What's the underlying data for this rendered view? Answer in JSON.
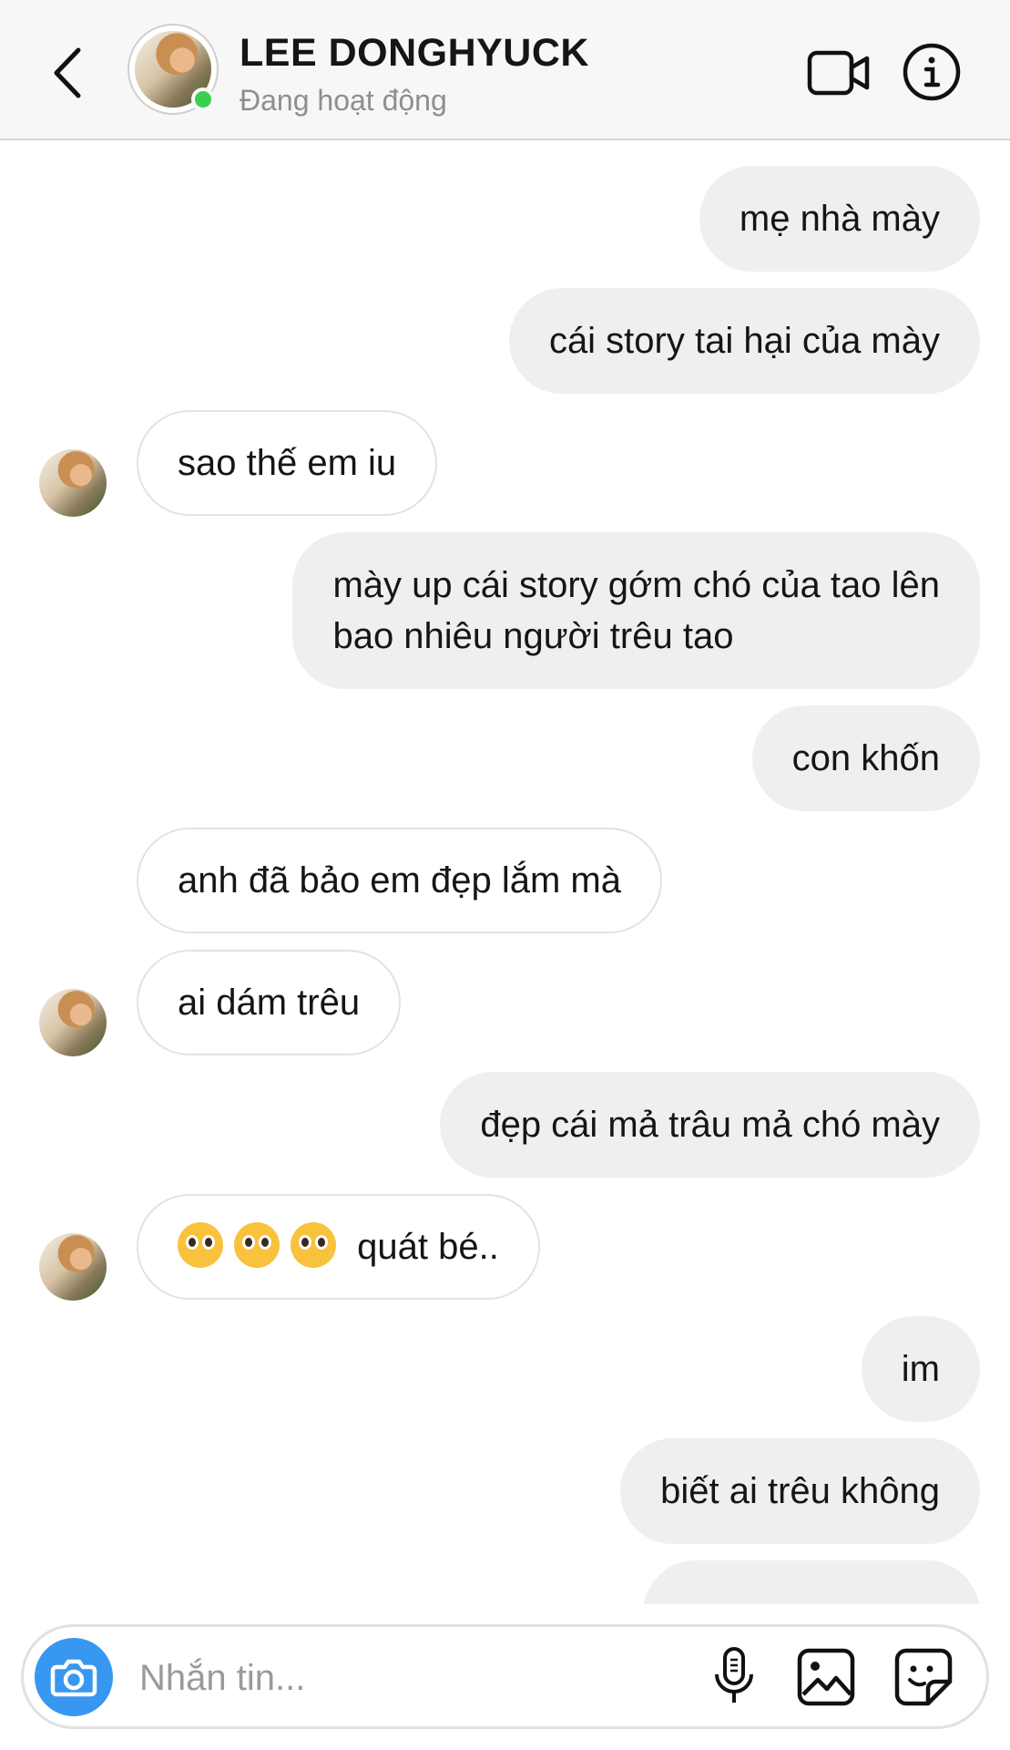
{
  "header": {
    "contact_name": "LEE DONGHYUCK",
    "status": "Đang hoạt động",
    "icons": [
      "chevron-left-icon",
      "video-camera-icon",
      "info-icon"
    ]
  },
  "messages": [
    {
      "side": "out",
      "text": "mẹ nhà mày"
    },
    {
      "side": "out",
      "text": "cái story tai hại của mày"
    },
    {
      "side": "in",
      "text": "sao thế em iu"
    },
    {
      "side": "out",
      "line1": "mày up cái story gớm chó của tao lên",
      "line2": "bao nhiêu người trêu tao"
    },
    {
      "side": "out",
      "text": "con khốn"
    },
    {
      "side": "in",
      "text": "anh đã bảo em đẹp lắm mà"
    },
    {
      "side": "in",
      "text": "ai dám trêu"
    },
    {
      "side": "out",
      "text": "đẹp cái mả trâu mả chó mày"
    },
    {
      "side": "in",
      "text": "quát bé..",
      "emoji": "pleading-face-icon x3"
    },
    {
      "side": "out",
      "text": "im"
    },
    {
      "side": "out",
      "text": "biết ai trêu không"
    },
    {
      "side": "out",
      "text": "…"
    }
  ],
  "composer": {
    "placeholder": "Nhắn tin...",
    "icons": [
      "camera-icon",
      "microphone-icon",
      "gallery-icon",
      "sticker-icon"
    ]
  },
  "colors": {
    "online": "#3ccf4e",
    "camera_button": "#3897f0",
    "outgoing_bubble": "#efefef",
    "incoming_border": "#e2e2e2"
  }
}
